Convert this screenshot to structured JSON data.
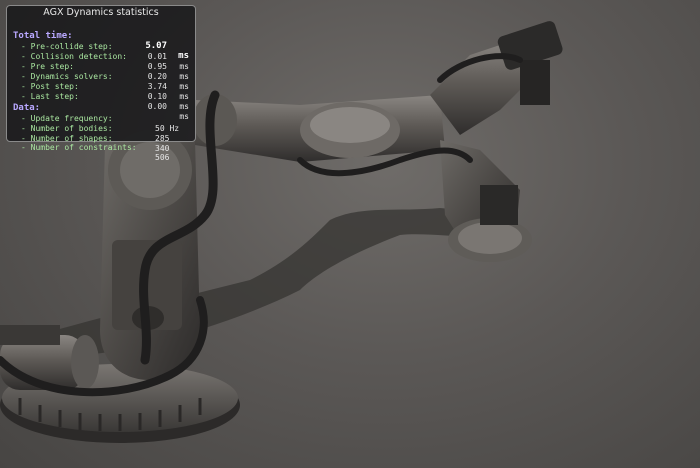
{
  "stats": {
    "title": "AGX Dynamics statistics",
    "total": {
      "label": "Total time:",
      "value": "5.07",
      "unit": "ms"
    },
    "timings": [
      {
        "label": "- Pre-collide step:",
        "value": "0.01",
        "unit": "ms"
      },
      {
        "label": "- Collision detection:",
        "value": "0.95",
        "unit": "ms"
      },
      {
        "label": "- Pre step:",
        "value": "0.20",
        "unit": "ms"
      },
      {
        "label": "- Dynamics solvers:",
        "value": "3.74",
        "unit": "ms"
      },
      {
        "label": "- Post step:",
        "value": "0.10",
        "unit": "ms"
      },
      {
        "label": "- Last step:",
        "value": "0.00",
        "unit": "ms"
      }
    ],
    "data_header": "Data:",
    "data": [
      {
        "label": "- Update frequency:",
        "value": "50 Hz"
      },
      {
        "label": "- Number of bodies:",
        "value": "285"
      },
      {
        "label": "- Number of shapes:",
        "value": "340"
      },
      {
        "label": "- Number of constraints:",
        "value": "506"
      }
    ]
  },
  "colors": {
    "panel_background": "#121214",
    "panel_border": "#8a8a8a",
    "header_text": "#b9a8ff",
    "subitem_text": "#a9e6a0",
    "value_text": "#e6e6e6",
    "floor": "#5b5856",
    "robot_body": "#4a4744",
    "cable": "#222222"
  },
  "scene": {
    "object": "robot-arm"
  }
}
